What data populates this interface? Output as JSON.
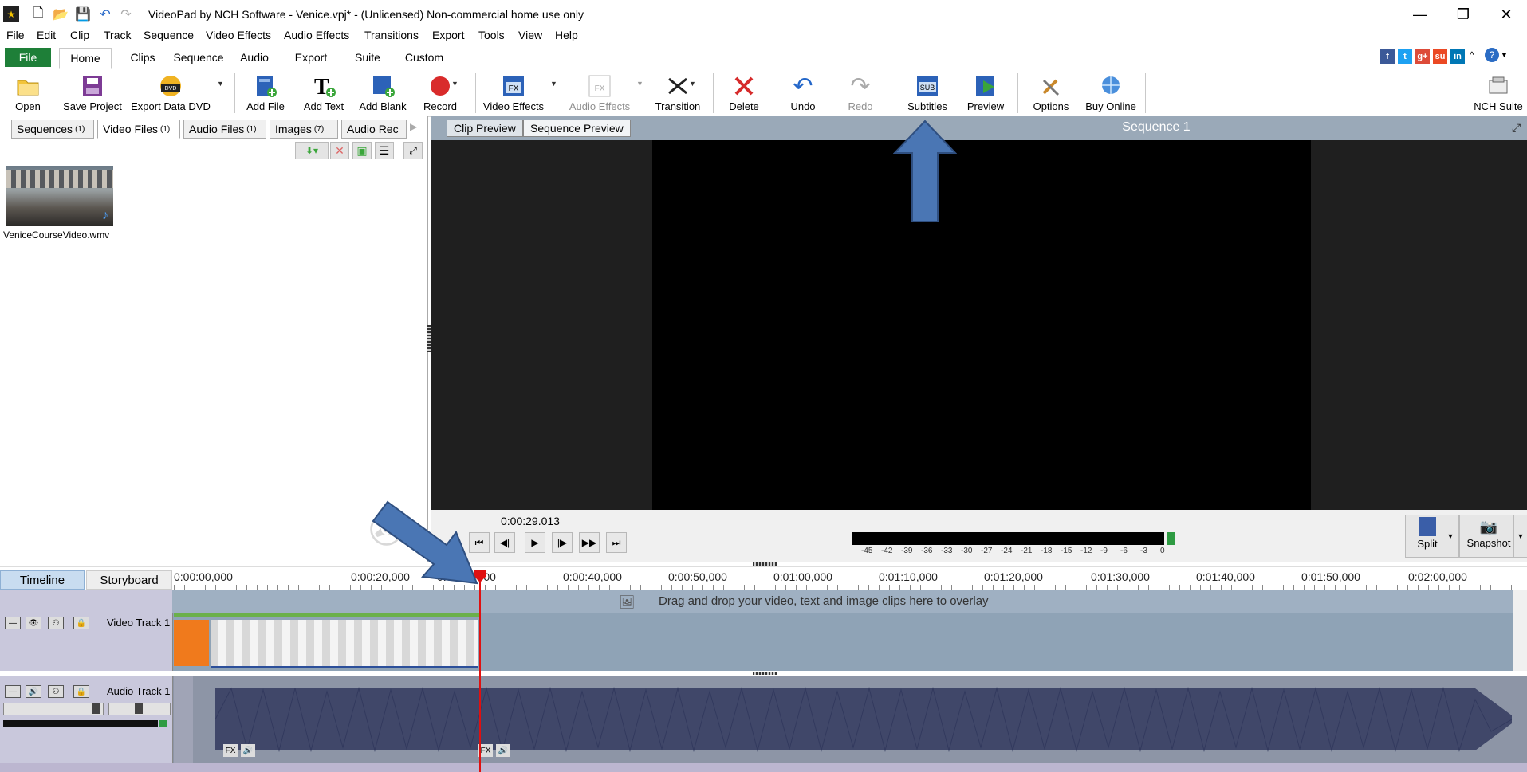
{
  "window": {
    "title": "VideoPad by NCH Software - Venice.vpj* - (Unlicensed) Non-commercial home use only",
    "controls": {
      "minimize": "—",
      "restore": "❐",
      "close": "✕"
    }
  },
  "menu": [
    "File",
    "Edit",
    "Clip",
    "Track",
    "Sequence",
    "Video Effects",
    "Audio Effects",
    "Transitions",
    "Export",
    "Tools",
    "View",
    "Help"
  ],
  "ribbon_tabs": [
    "File",
    "Home",
    "Clips",
    "Sequence",
    "Audio",
    "Export",
    "Suite",
    "Custom"
  ],
  "social": [
    "f",
    "t",
    "g+",
    "su",
    "in"
  ],
  "toolbar": {
    "open": "Open",
    "save_project": "Save Project",
    "export_data_dvd": "Export Data DVD",
    "add_file": "Add File",
    "add_text": "Add Text",
    "add_blank": "Add Blank",
    "record": "Record",
    "video_effects": "Video Effects",
    "audio_effects": "Audio Effects",
    "transition": "Transition",
    "delete": "Delete",
    "undo": "Undo",
    "redo": "Redo",
    "subtitles": "Subtitles",
    "preview": "Preview",
    "options": "Options",
    "buy_online": "Buy Online",
    "nch_suite": "NCH Suite",
    "dvd_badge": "DVD",
    "sub_badge": "SUB",
    "fx_badge": "FX"
  },
  "bin_tabs": [
    {
      "label": "Sequences",
      "count": "(1)"
    },
    {
      "label": "Video Files",
      "count": "(1)"
    },
    {
      "label": "Audio Files",
      "count": "(1)"
    },
    {
      "label": "Images",
      "count": "(7)"
    },
    {
      "label": "Audio Rec",
      "count": ""
    }
  ],
  "media_file": {
    "name": "VeniceCourseVideo.wmv"
  },
  "preview": {
    "tabs": [
      "Clip Preview",
      "Sequence Preview"
    ],
    "sequence_title": "Sequence 1",
    "timecode": "0:00:29.013",
    "meter_ticks": [
      "-45",
      "-42",
      "-39",
      "-36",
      "-33",
      "-30",
      "-27",
      "-24",
      "-21",
      "-18",
      "-15",
      "-12",
      "-9",
      "-6",
      "-3",
      "0"
    ],
    "split": "Split",
    "snapshot": "Snapshot"
  },
  "timeline": {
    "tabs": [
      "Timeline",
      "Storyboard"
    ],
    "ruler": [
      "0:00:00,000",
      "0:00:20,000",
      "0:00:30,000",
      "0:00:40,000",
      "0:00:50,000",
      "0:01:00,000",
      "0:01:10,000",
      "0:01:20,000",
      "0:01:30,000",
      "0:01:40,000",
      "0:01:50,000",
      "0:02:00,000"
    ],
    "overlay_hint": "Drag and drop your video, text and image clips here to overlay",
    "video_track": "Video Track 1",
    "audio_track": "Audio Track 1",
    "fx": "FX"
  },
  "colors": {
    "ribbon_file": "#1e7f38",
    "playhead": "#e01010",
    "annotation_arrow": "#4a76b4",
    "timeline_tab": "#c8dcf0"
  }
}
